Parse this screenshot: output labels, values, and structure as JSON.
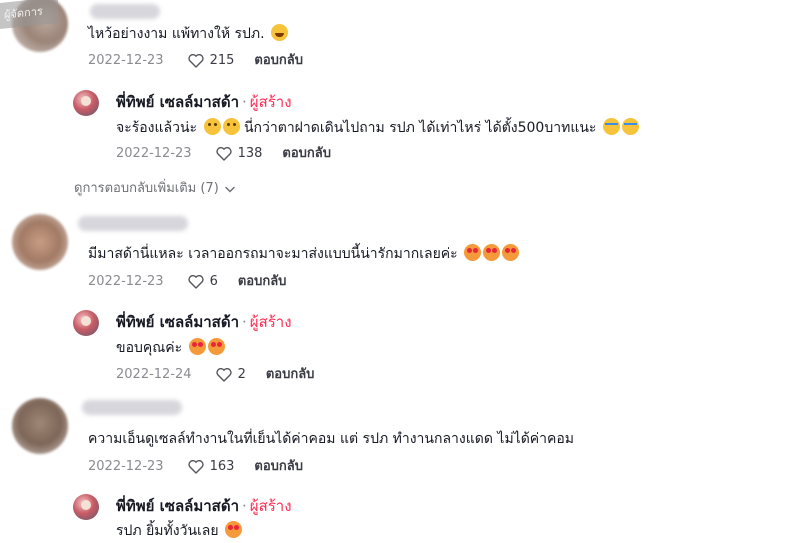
{
  "watermark": "ผู้จัดการ",
  "comments": [
    {
      "text": "ไหว้อย่างงาม แพ้ทางให้ รปภ.",
      "emojis": [
        "rofl"
      ],
      "date": "2022-12-23",
      "likes": "215",
      "reply_label": "ตอบกลับ",
      "reply": {
        "author": "พี่ทิพย์ เซลล์มาสด้า",
        "creator_label": "ผู้สร้าง",
        "text": "จะร้องแล้วน่ะ",
        "text2": "นี่กว่าตาฝาดเดินไปถาม รปภ ได้เท่าไหร่ ได้ตั้ง500บาทแนะ",
        "date": "2022-12-23",
        "likes": "138",
        "reply_label": "ตอบกลับ"
      }
    },
    {
      "text": "มีมาสด้านี่แหละ เวลาออกรถมาจะมาส่งแบบนี้น่ารักมากเลยค่ะ",
      "emojis": [
        "love",
        "love",
        "love"
      ],
      "date": "2022-12-23",
      "likes": "6",
      "reply_label": "ตอบกลับ",
      "reply": {
        "author": "พี่ทิพย์ เซลล์มาสด้า",
        "creator_label": "ผู้สร้าง",
        "text": "ขอบคุณค่ะ",
        "date": "2022-12-24",
        "likes": "2",
        "reply_label": "ตอบกลับ"
      }
    },
    {
      "text": "ความเอ็นดูเซลล์ทำงานในที่เย็นได้ค่าคอม แต่ รปภ ทำงานกลางแดด ไม่ได้ค่าคอม",
      "date": "2022-12-23",
      "likes": "163",
      "reply_label": "ตอบกลับ",
      "reply": {
        "author": "พี่ทิพย์ เซลล์มาสด้า",
        "creator_label": "ผู้สร้าง",
        "text": "รปภ ยิ้มทั้งวันเลย"
      }
    }
  ],
  "view_more": "ดูการตอบกลับเพิ่มเติม (7)"
}
